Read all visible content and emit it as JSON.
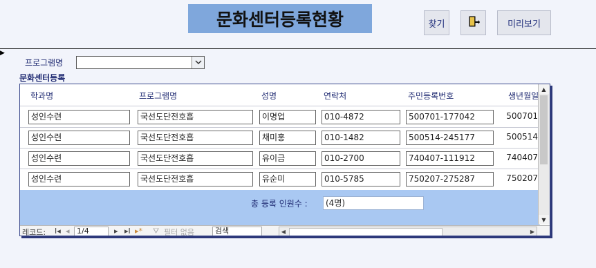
{
  "header": {
    "title": "문화센터등록현황",
    "find_label": "찾기",
    "exit_icon": "exit-door-icon",
    "preview_label": "미리보기"
  },
  "filter": {
    "label": "프로그램명",
    "value": ""
  },
  "section_title": "문화센터등록",
  "columns": [
    "학과명",
    "프로그램명",
    "성명",
    "연락처",
    "주민등록번호",
    "생년월일"
  ],
  "rows": [
    {
      "dept": "성인수련",
      "program": "국선도단전호흡",
      "name": "이명업",
      "phone": "010-4872",
      "rrn": "500701-177042",
      "birth": "500701"
    },
    {
      "dept": "성인수련",
      "program": "국선도단전호흡",
      "name": "채미홍",
      "phone": "010-1482",
      "rrn": "500514-245177",
      "birth": "500514"
    },
    {
      "dept": "성인수련",
      "program": "국선도단전호흡",
      "name": "유이금",
      "phone": "010-2700",
      "rrn": "740407-111912",
      "birth": "740407"
    },
    {
      "dept": "성인수련",
      "program": "국선도단전호흡",
      "name": "유순미",
      "phone": "010-5785",
      "rrn": "750207-275287",
      "birth": "750207"
    }
  ],
  "footer": {
    "total_label": "총 등록 인원수 :",
    "total_value": "(4명)"
  },
  "navigator": {
    "record_label": "레코드:",
    "position": "1/4",
    "filter_label": "필터 없음",
    "search_placeholder": "검색"
  },
  "colors": {
    "title_bg": "#7fa7dc",
    "footer_bg": "#a9c8f2",
    "label_text": "#1f2a72"
  }
}
